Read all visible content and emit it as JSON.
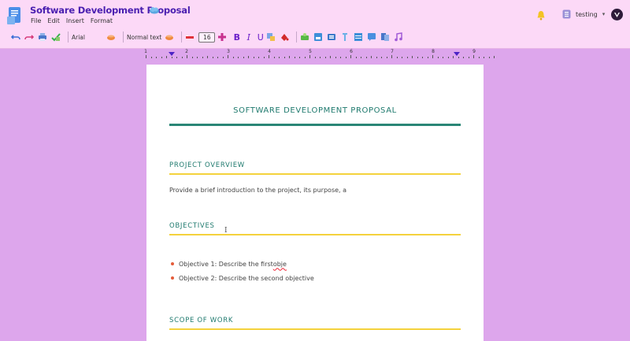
{
  "app": {
    "title": "Software Development Proposal",
    "menu": [
      "File",
      "Edit",
      "Insert",
      "Format"
    ],
    "account_label": "testing"
  },
  "toolbar": {
    "font_name": "Arial",
    "text_style": "Normal text",
    "font_size": "16",
    "bold": "B",
    "italic": "I",
    "underline": "U"
  },
  "ruler": {
    "numbers": [
      "1",
      "2",
      "3",
      "4",
      "5",
      "6",
      "7",
      "8",
      "9"
    ]
  },
  "document": {
    "title": "SOFTWARE DEVELOPMENT PROPOSAL",
    "sections": [
      {
        "heading": "PROJECT OVERVIEW"
      },
      {
        "heading": "OBJECTIVES"
      },
      {
        "heading": "SCOPE OF WORK"
      }
    ],
    "overview_text": "Provide a brief introduction to the project, its purpose, a",
    "objectives": [
      {
        "prefix": "Objective 1: Describe the first ",
        "misspelled": "obje"
      },
      {
        "prefix": "Objective 2: Describe the second objective",
        "misspelled": ""
      }
    ]
  },
  "colors": {
    "header_bg": "#fcd9f7",
    "page_bg": "#dda6ec",
    "heading_teal": "#1f7a6e",
    "accent_yellow": "#f4d23c",
    "title_purple": "#4a1fb0"
  }
}
